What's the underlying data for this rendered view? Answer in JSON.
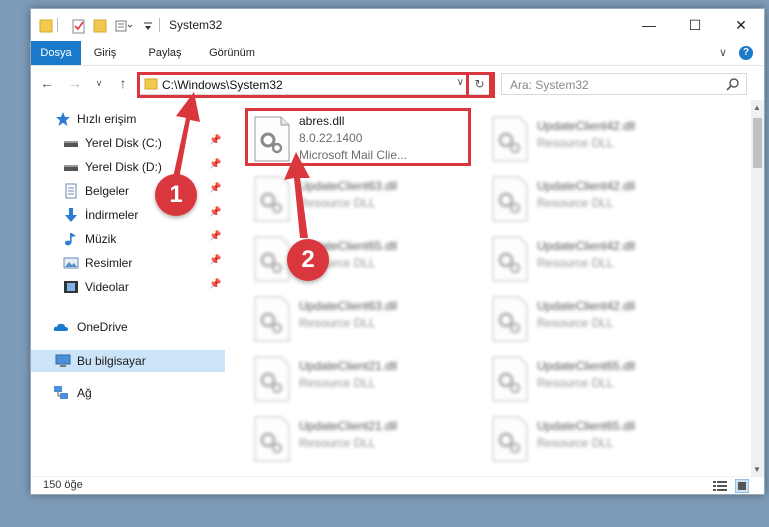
{
  "window": {
    "title": "System32",
    "controls": {
      "minimize": "—",
      "maximize": "☐",
      "close": "✕"
    }
  },
  "ribbon": {
    "tabs": [
      {
        "label": "Dosya",
        "active": true
      },
      {
        "label": "Giriş"
      },
      {
        "label": "Paylaş"
      },
      {
        "label": "Görünüm"
      }
    ],
    "expand": "∨",
    "help": "?"
  },
  "nav": {
    "back": "←",
    "forward": "→",
    "recent": "∨",
    "up": "↑",
    "address": "C:\\Windows\\System32",
    "address_dropdown": "∨",
    "refresh": "↻",
    "search_placeholder": "Ara: System32"
  },
  "sidebar": {
    "items": [
      {
        "label": "Hızlı erişim",
        "icon": "star-icon"
      },
      {
        "label": "Yerel Disk (C:)",
        "icon": "drive-icon",
        "pinned": true
      },
      {
        "label": "Yerel Disk (D:)",
        "icon": "drive-icon",
        "pinned": true
      },
      {
        "label": "Belgeler",
        "icon": "documents-icon",
        "pinned": true
      },
      {
        "label": "İndirmeler",
        "icon": "download-icon",
        "pinned": true
      },
      {
        "label": "Müzik",
        "icon": "music-icon",
        "pinned": true
      },
      {
        "label": "Resimler",
        "icon": "pictures-icon",
        "pinned": true
      },
      {
        "label": "Videolar",
        "icon": "videos-icon",
        "pinned": true
      },
      {
        "label": "OneDrive",
        "icon": "cloud-icon"
      },
      {
        "label": "Bu bilgisayar",
        "icon": "computer-icon",
        "selected": true
      },
      {
        "label": "Ağ",
        "icon": "network-icon"
      }
    ],
    "pin_glyph": "📌"
  },
  "files": {
    "left": [
      {
        "name": "abres.dll",
        "version": "8.0.22.1400",
        "description": "Microsoft Mail Clie...",
        "highlighted": true
      },
      {
        "name": "UpdateClient63.dll",
        "description": "Resource DLL"
      },
      {
        "name": "UpdateClient65.dll",
        "description": "Resource DLL"
      },
      {
        "name": "UpdateClient63.dll",
        "description": "Resource DLL"
      },
      {
        "name": "UpdateClient21.dll",
        "description": "Resource DLL"
      },
      {
        "name": "UpdateClient21.dll",
        "description": "Resource DLL"
      }
    ],
    "right": [
      {
        "name": "UpdateClient42.dll",
        "description": "Resource DLL"
      },
      {
        "name": "UpdateClient42.dll",
        "description": "Resource DLL"
      },
      {
        "name": "UpdateClient42.dll",
        "description": "Resource DLL"
      },
      {
        "name": "UpdateClient42.dll",
        "description": "Resource DLL"
      },
      {
        "name": "UpdateClient65.dll",
        "description": "Resource DLL"
      },
      {
        "name": "UpdateClient65.dll",
        "description": "Resource DLL"
      }
    ]
  },
  "status": {
    "count": "150 öğe"
  },
  "callouts": [
    "1",
    "2"
  ],
  "colors": {
    "accent": "#1979ca",
    "annotation": "#d9363e",
    "selected": "#cce4f7"
  }
}
